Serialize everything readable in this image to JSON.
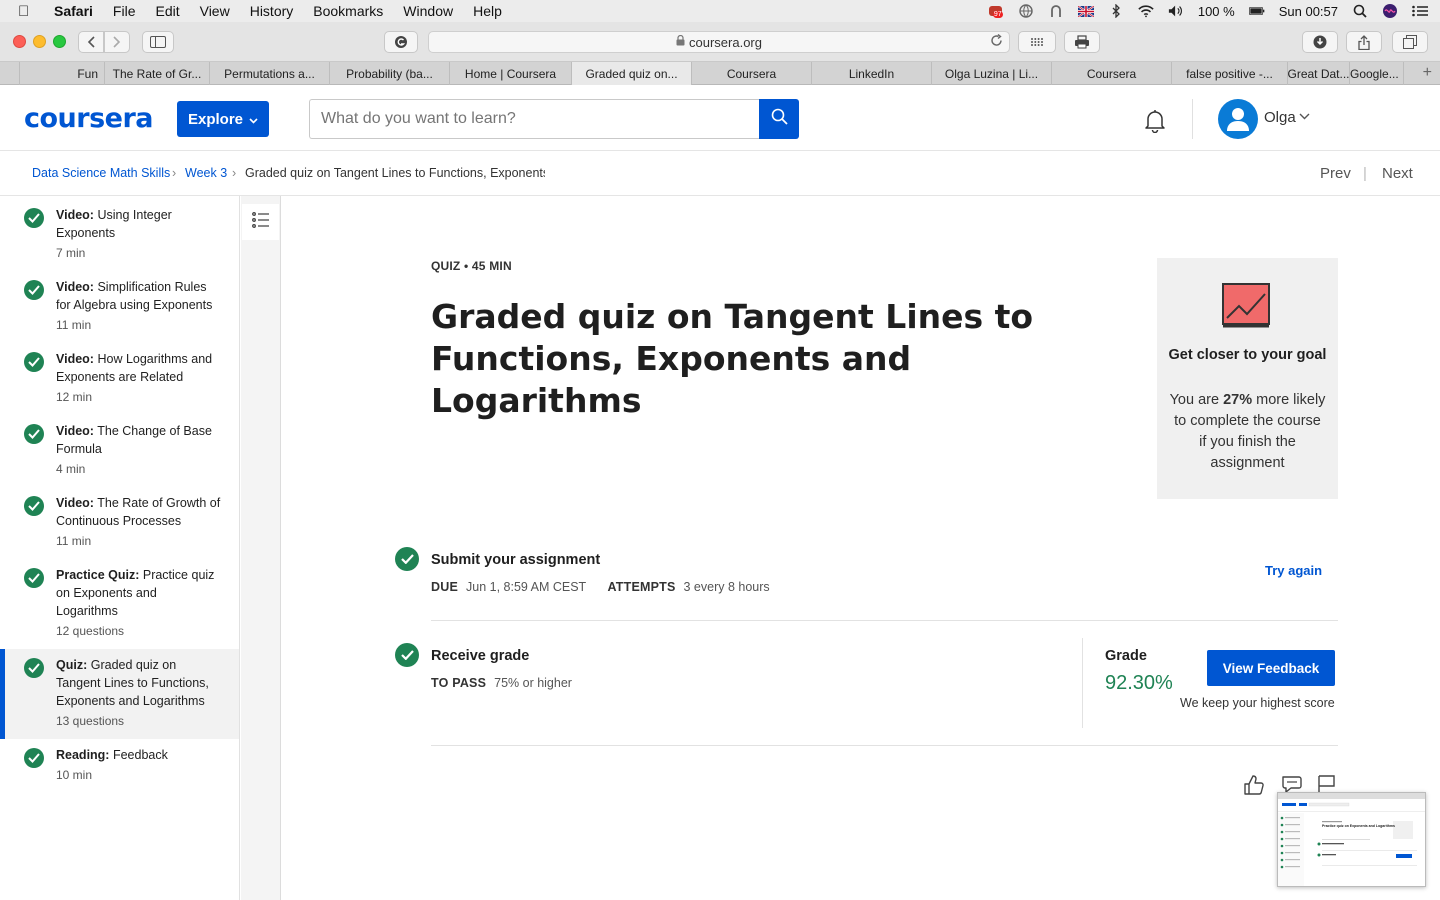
{
  "menubar": {
    "app": "Safari",
    "items": [
      "File",
      "Edit",
      "View",
      "History",
      "Bookmarks",
      "Window",
      "Help"
    ],
    "battery": "100 %",
    "clock": "Sun 00:57",
    "notif_badge": "97"
  },
  "browser": {
    "url": "coursera.org",
    "tabs": [
      {
        "label": "Fun"
      },
      {
        "label": "The Rate of Gr..."
      },
      {
        "label": "Permutations a..."
      },
      {
        "label": "Probability (ba..."
      },
      {
        "label": "Home | Coursera"
      },
      {
        "label": "Graded quiz on..."
      },
      {
        "label": "Coursera"
      },
      {
        "label": "LinkedIn"
      },
      {
        "label": "Olga Luzina | Li..."
      },
      {
        "label": "Coursera"
      },
      {
        "label": "false positive -..."
      },
      {
        "label": "Great Dat..."
      },
      {
        "label": "Google..."
      }
    ],
    "active_tab": 5
  },
  "header": {
    "logo": "coursera",
    "explore_label": "Explore",
    "search_placeholder": "What do you want to learn?",
    "user_name": "Olga"
  },
  "breadcrumb": {
    "items": [
      "Data Science Math Skills",
      "Week 3",
      "Graded quiz on Tangent Lines to Functions, Exponents and Logarithms"
    ],
    "prev": "Prev",
    "next": "Next"
  },
  "sidebar": {
    "items": [
      {
        "type": "Video:",
        "title": "Using Integer Exponents",
        "meta": "7 min"
      },
      {
        "type": "Video:",
        "title": "Simplification Rules for Algebra using Exponents",
        "meta": "11 min"
      },
      {
        "type": "Video:",
        "title": "How Logarithms and Exponents are Related",
        "meta": "12 min"
      },
      {
        "type": "Video:",
        "title": "The Change of Base Formula",
        "meta": "4 min"
      },
      {
        "type": "Video:",
        "title": "The Rate of Growth of Continuous Processes",
        "meta": "11 min"
      },
      {
        "type": "Practice Quiz:",
        "title": "Practice quiz on Exponents and Logarithms",
        "meta": "12 questions"
      },
      {
        "type": "Quiz:",
        "title": "Graded quiz on Tangent Lines to Functions, Exponents and Logarithms",
        "meta": "13 questions"
      },
      {
        "type": "Reading:",
        "title": "Feedback",
        "meta": "10 min"
      }
    ],
    "active_index": 6
  },
  "main": {
    "kicker": "QUIZ • 45 MIN",
    "title": "Graded quiz on Tangent Lines to Functions, Exponents and Logarithms",
    "goal": {
      "heading": "Get closer to your goal",
      "text_before": "You are ",
      "percent": "27%",
      "text_after": " more likely to complete the course if you finish the assignment"
    },
    "submit": {
      "heading": "Submit your assignment",
      "due_label": "DUE",
      "due_value": "Jun 1, 8:59 AM CEST",
      "attempts_label": "ATTEMPTS",
      "attempts_value": "3 every 8 hours",
      "try_again": "Try again"
    },
    "receive": {
      "heading": "Receive grade",
      "pass_label": "TO PASS",
      "pass_value": "75% or higher",
      "grade_label": "Grade",
      "grade_value": "92.30%",
      "view_feedback": "View Feedback",
      "keep_note": "We keep your highest score"
    },
    "thumb": {
      "title": "Practice quiz on Exponents and Logarithms"
    }
  },
  "colors": {
    "brand": "#0056d2",
    "success": "#1f8354"
  }
}
